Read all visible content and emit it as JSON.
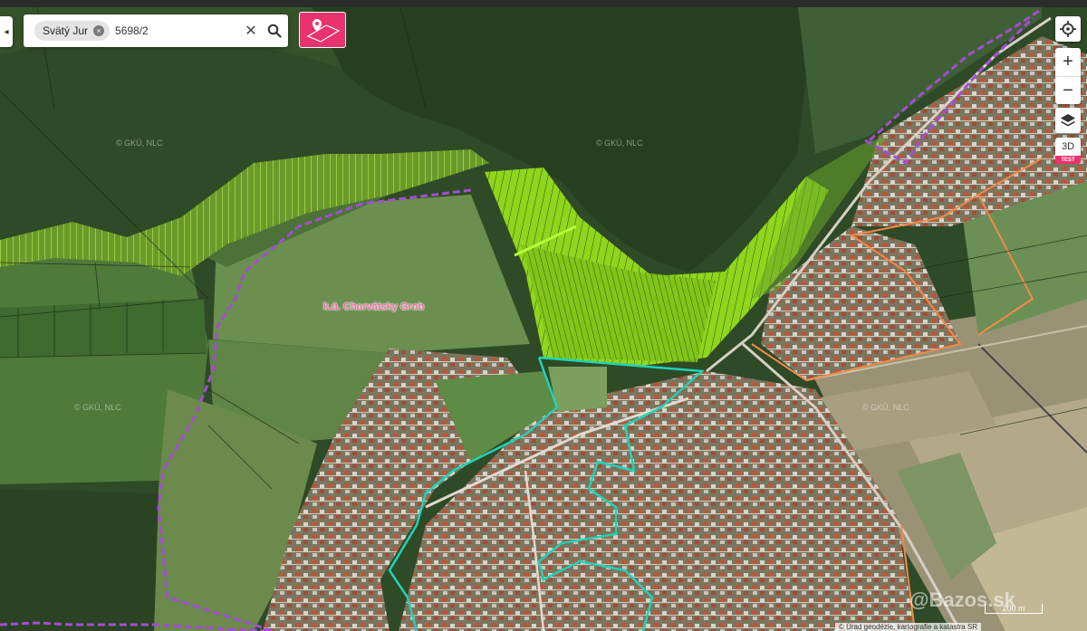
{
  "search": {
    "chip_label": "Svätý Jur",
    "query": "5698/2",
    "chip_remove_glyph": "×",
    "clear_glyph": "✕"
  },
  "controls": {
    "zoom_in": "+",
    "zoom_out": "−",
    "mode_3d": "3D",
    "badge": "TEST",
    "collapse_glyph": "◂"
  },
  "map": {
    "cadastral_label": "k.ú. Chorvátsky Grob",
    "watermarks": [
      "© GKÚ, NLC",
      "© GKÚ, NLC",
      "© GKÚ, NLC",
      "© GKÚ, NLC"
    ],
    "scale_label": "200 m",
    "attribution": "© Úrad geodézie, kartografie a katastra SR",
    "site_watermark": "@Bazos.sk"
  },
  "colors": {
    "accent": "#e8336e",
    "forest": "#2f4a26",
    "field": "#5f8a45",
    "parcel_highlight": "#9be01c",
    "cadastral_border": "#a24fd0",
    "district_boundary": "#1fd3b8",
    "urban_boundary": "#f08a4b"
  },
  "icons": {
    "search": "search-icon",
    "pin": "map-pin-icon",
    "locate": "crosshair-icon",
    "layers": "layers-icon"
  }
}
